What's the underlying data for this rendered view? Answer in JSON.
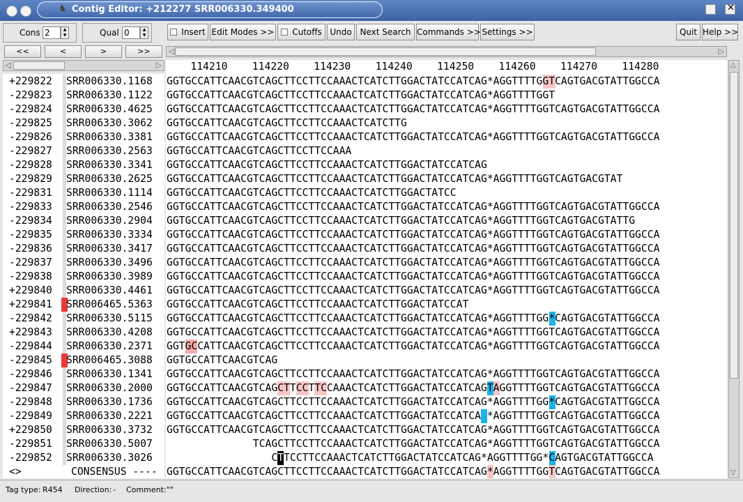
{
  "window": {
    "title": "Contig Editor: +212277 SRR006330.349400",
    "icon": "gap-icon"
  },
  "toolbar": {
    "cons_label": "Cons",
    "cons_value": "2",
    "qual_label": "Qual",
    "qual_value": "0",
    "insert_label": "Insert",
    "edit_modes_label": "Edit Modes >>",
    "cutoffs_label": "Cutoffs",
    "undo_label": "Undo",
    "next_search_label": "Next Search",
    "commands_label": "Commands >>",
    "settings_label": "Settings >>",
    "quit_label": "Quit",
    "help_label": "Help >>",
    "nav": [
      "<<",
      "<",
      ">",
      ">>"
    ]
  },
  "ruler": {
    "text": "    114210    114220    114230    114240    114250    114260    114270    114280"
  },
  "reads": [
    {
      "num": "+229822",
      "name": "SRR006330.1168",
      "seq": "GGTGCCATTCAACGTCAGCTTCCTTCCAAACTCATCTTGGACTATCCATCAG*AGGTTTTGGTCAGTGACGTATTGGCCA",
      "marked": false
    },
    {
      "num": "-229823",
      "name": "SRR006330.1122",
      "seq": "GGTGCCATTCAACGTCAGCTTCCTTCCAAACTCATCTTGGACTATCCATCAG*AGGTTTTGGT",
      "marked": false
    },
    {
      "num": "-229824",
      "name": "SRR006330.4625",
      "seq": "GGTGCCATTCAACGTCAGCTTCCTTCCAAACTCATCTTGGACTATCCATCAG*AGGTTTTGGTCAGTGACGTATTGGCCA",
      "marked": false
    },
    {
      "num": "-229825",
      "name": "SRR006330.3062",
      "seq": "GGTGCCATTCAACGTCAGCTTCCTTCCAAACTCATCTTG",
      "marked": false
    },
    {
      "num": "-229826",
      "name": "SRR006330.3381",
      "seq": "GGTGCCATTCAACGTCAGCTTCCTTCCAAACTCATCTTGGACTATCCATCAG*AGGTTTTGGTCAGTGACGTATTGGCCA",
      "marked": false
    },
    {
      "num": "-229827",
      "name": "SRR006330.2563",
      "seq": "GGTGCCATTCAACGTCAGCTTCCTTCCAAA",
      "marked": false
    },
    {
      "num": "-229828",
      "name": "SRR006330.3341",
      "seq": "GGTGCCATTCAACGTCAGCTTCCTTCCAAACTCATCTTGGACTATCCATCAG",
      "marked": false
    },
    {
      "num": "-229829",
      "name": "SRR006330.2625",
      "seq": "GGTGCCATTCAACGTCAGCTTCCTTCCAAACTCATCTTGGACTATCCATCAG*AGGTTTTGGTCAGTGACGTAT",
      "marked": false
    },
    {
      "num": "-229831",
      "name": "SRR006330.1114",
      "seq": "GGTGCCATTCAACGTCAGCTTCCTTCCAAACTCATCTTGGACTATCC",
      "marked": false
    },
    {
      "num": "-229833",
      "name": "SRR006330.2546",
      "seq": "GGTGCCATTCAACGTCAGCTTCCTTCCAAACTCATCTTGGACTATCCATCAG*AGGTTTTGGTCAGTGACGTATTGGCCA",
      "marked": false
    },
    {
      "num": "-229834",
      "name": "SRR006330.2904",
      "seq": "GGTGCCATTCAACGTCAGCTTCCTTCCAAACTCATCTTGGACTATCCATCAG*AGGTTTTGGTCAGTGACGTATTG",
      "marked": false
    },
    {
      "num": "-229835",
      "name": "SRR006330.3334",
      "seq": "GGTGCCATTCAACGTCAGCTTCCTTCCAAACTCATCTTGGACTATCCATCAG*AGGTTTTGGTCAGTGACGTATTGGCCA",
      "marked": false
    },
    {
      "num": "-229836",
      "name": "SRR006330.3417",
      "seq": "GGTGCCATTCAACGTCAGCTTCCTTCCAAACTCATCTTGGACTATCCATCAG*AGGTTTTGGTCAGTGACGTATTGGCCA",
      "marked": false
    },
    {
      "num": "-229837",
      "name": "SRR006330.3496",
      "seq": "GGTGCCATTCAACGTCAGCTTCCTTCCAAACTCATCTTGGACTATCCATCAG*AGGTTTTGGTCAGTGACGTATTGGCCA",
      "marked": false
    },
    {
      "num": "-229838",
      "name": "SRR006330.3989",
      "seq": "GGTGCCATTCAACGTCAGCTTCCTTCCAAACTCATCTTGGACTATCCATCAG*AGGTTTTGGTCAGTGACGTATTGGCCA",
      "marked": false
    },
    {
      "num": "+229840",
      "name": "SRR006330.4461",
      "seq": "GGTGCCATTCAACGTCAGCTTCCTTCCAAACTCATCTTGGACTATCCATCAG*AGGTTTTGGTCAGTGACGTATTGGCCA",
      "marked": false
    },
    {
      "num": "+229841",
      "name": "SRR006465.5363",
      "seq": "GGTGCCATTCAACGTCAGCTTCCTTCCAAACTCATCTTGGACTATCCAT",
      "marked": true
    },
    {
      "num": "-229842",
      "name": "SRR006330.5115",
      "seq": "GGTGCCATTCAACGTCAGCTTCCTTCCAAACTCATCTTGGACTATCCATCAG*AGGTTTTGG*CAGTGACGTATTGGCCA",
      "marked": false
    },
    {
      "num": "+229843",
      "name": "SRR006330.4208",
      "seq": "GGTGCCATTCAACGTCAGCTTCCTTCCAAACTCATCTTGGACTATCCATCAG*AGGTTTTGGTCAGTGACGTATTGGCCA",
      "marked": false
    },
    {
      "num": "-229844",
      "name": "SRR006330.2371",
      "seq": "GGTGCCATTCAACGTCAGCTTCCTTCCAAACTCATCTTGGACTATCCATCAG*AGGTTTTGGTCAGTGACGTATTGGCCA",
      "marked": false
    },
    {
      "num": "-229845",
      "name": "SRR006465.3088",
      "seq": "GGTGCCATTCAACGTCAG",
      "marked": true
    },
    {
      "num": "-229846",
      "name": "SRR006330.1341",
      "seq": "GGTGCCATTCAACGTCAGCTTCCTTCCAAACTCATCTTGGACTATCCATCAG*AGGTTTTGGTCAGTGACGTATTGGCCA",
      "marked": false
    },
    {
      "num": "-229847",
      "name": "SRR006330.2000",
      "seq": "GGTGCCATTCAACGTCAGCTTCCTTCCAAACTCATCTTGGACTATCCATCAGTAGGTTTTGGTCAGTGACGTATTGGCCA",
      "marked": false
    },
    {
      "num": "-229848",
      "name": "SRR006330.1736",
      "seq": "GGTGCCATTCAACGTCAGCTTCCTTCCAAACTCATCTTGGACTATCCATCAG*AGGTTTTGG*CAGTGACGTATTGGCCA",
      "marked": false
    },
    {
      "num": "-229849",
      "name": "SRR006330.2221",
      "seq": "GGTGCCATTCAACGTCAGCTTCCTTCCAAACTCATCTTGGACTATCCATCA *AGGTTTTGGTCAGTGACGTATTGGCCA",
      "marked": false
    },
    {
      "num": "+229850",
      "name": "SRR006330.3732",
      "seq": "GGTGCCATTCAACGTCAGCTTCCTTCCAAACTCATCTTGGACTATCCATCAG*AGGTTTTGGTCAGTGACGTATTGGCCA",
      "marked": false
    },
    {
      "num": "-229851",
      "name": "SRR006330.5007",
      "seq": "              TCAGCTTCCTTCCAAACTCATCTTGGACTATCCATCAG*AGGTTTTGGTCAGTGACGTATTGGCCA",
      "marked": false
    },
    {
      "num": "-229852",
      "name": "SRR006330.3026",
      "seq": "                 CTTCCTTCCAAACTCATCTTGGACTATCCATCAG*AGGTTTTGG*CAGTGACGTATTGGCCA",
      "marked": false
    }
  ],
  "consensus": {
    "num": "<>",
    "name": "CONSENSUS ----",
    "seq": "GGTGCCATTCAACGTCAGCTTCCTTCCAAACTCATCTTGGACTATCCATCAG*AGGTTTTGGTCAGTGACGTATTGGCCA"
  },
  "status": {
    "tag_type_label": "Tag type:",
    "tag_type": "R454",
    "direction_label": "Direction:",
    "direction": "-",
    "comment_label": "Comment:",
    "comment": "\"\""
  },
  "colors": {
    "pink": "#f8c6c6",
    "blue": "#1eb3e6",
    "red_marker": "#e83a3a"
  }
}
